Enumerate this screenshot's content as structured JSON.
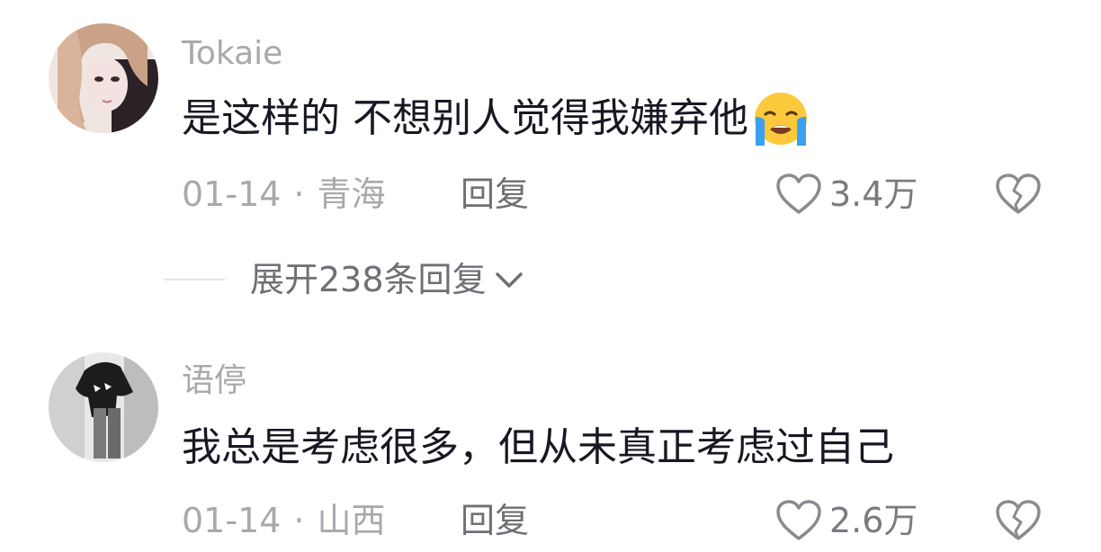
{
  "comments": [
    {
      "username": "Tokaie",
      "content": "是这样的 不想别人觉得我嫌弃他",
      "emoji": "loudly-crying-face",
      "date": "01-14",
      "separator": "·",
      "location": "青海",
      "reply_label": "回复",
      "likes": "3.4万"
    },
    {
      "username": "语停",
      "content": "我总是考虑很多，但从未真正考虑过自己",
      "date": "01-14",
      "separator": "·",
      "location": "山西",
      "reply_label": "回复",
      "likes": "2.6万"
    }
  ],
  "expand_replies": {
    "label": "展开238条回复",
    "icon": "chevron-down-icon"
  },
  "icons": {
    "like": "heart-outline-icon",
    "dislike": "broken-heart-icon"
  },
  "colors": {
    "text": "#161823",
    "muted": "#a8a8ad",
    "secondary": "#6f6f75"
  }
}
